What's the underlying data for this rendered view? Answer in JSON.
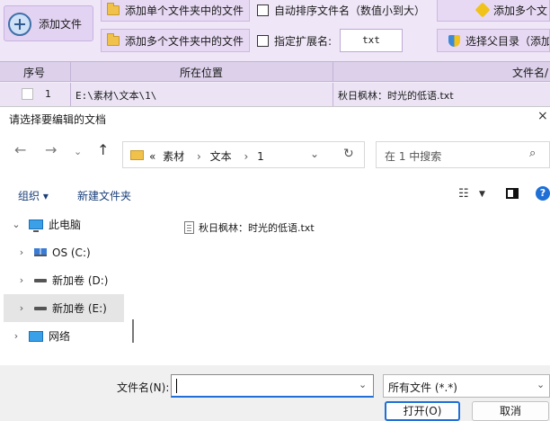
{
  "toolbar": {
    "add_file": "添加文件",
    "add_single_folder": "添加单个文件夹中的文件",
    "add_multi_folder": "添加多个文件夹中的文件",
    "auto_sort": "自动排序文件名（数值小到大）",
    "specify_ext": "指定扩展名:",
    "ext_value": "txt",
    "add_multi_right": "添加多个文",
    "select_parent": "选择父目录（添加"
  },
  "table": {
    "headers": [
      "序号",
      "所在位置",
      "文件名/"
    ],
    "rows": [
      {
        "index": "1",
        "location": "E:\\素材\\文本\\1\\",
        "filename": "秋日枫林：时光的低语.txt"
      }
    ]
  },
  "dialog": {
    "title": "请选择要编辑的文档",
    "close": "×",
    "breadcrumb": [
      "«",
      "素材",
      "›",
      "文本",
      "›",
      "1"
    ],
    "search_placeholder": "在 1 中搜索",
    "organize": "组织 ▾",
    "new_folder": "新建文件夹",
    "nav_tree": [
      {
        "arrow": "⌄",
        "label": "此电脑",
        "icon": "computer-icon"
      },
      {
        "arrow": "›",
        "label": "OS (C:)",
        "icon": "os-drive-icon"
      },
      {
        "arrow": "›",
        "label": "新加卷 (D:)",
        "icon": "drive-icon"
      },
      {
        "arrow": "›",
        "label": "新加卷 (E:)",
        "icon": "drive-icon",
        "selected": true
      },
      {
        "arrow": "›",
        "label": "网络",
        "icon": "network-icon"
      }
    ],
    "files": [
      {
        "name": "秋日枫林：时光的低语.txt",
        "icon": "text-file-icon"
      }
    ],
    "filename_label": "文件名(N):",
    "filename_value": "",
    "filetype_value": "所有文件 (*.*)",
    "open_button": "打开(O)",
    "cancel_button": "取消"
  }
}
